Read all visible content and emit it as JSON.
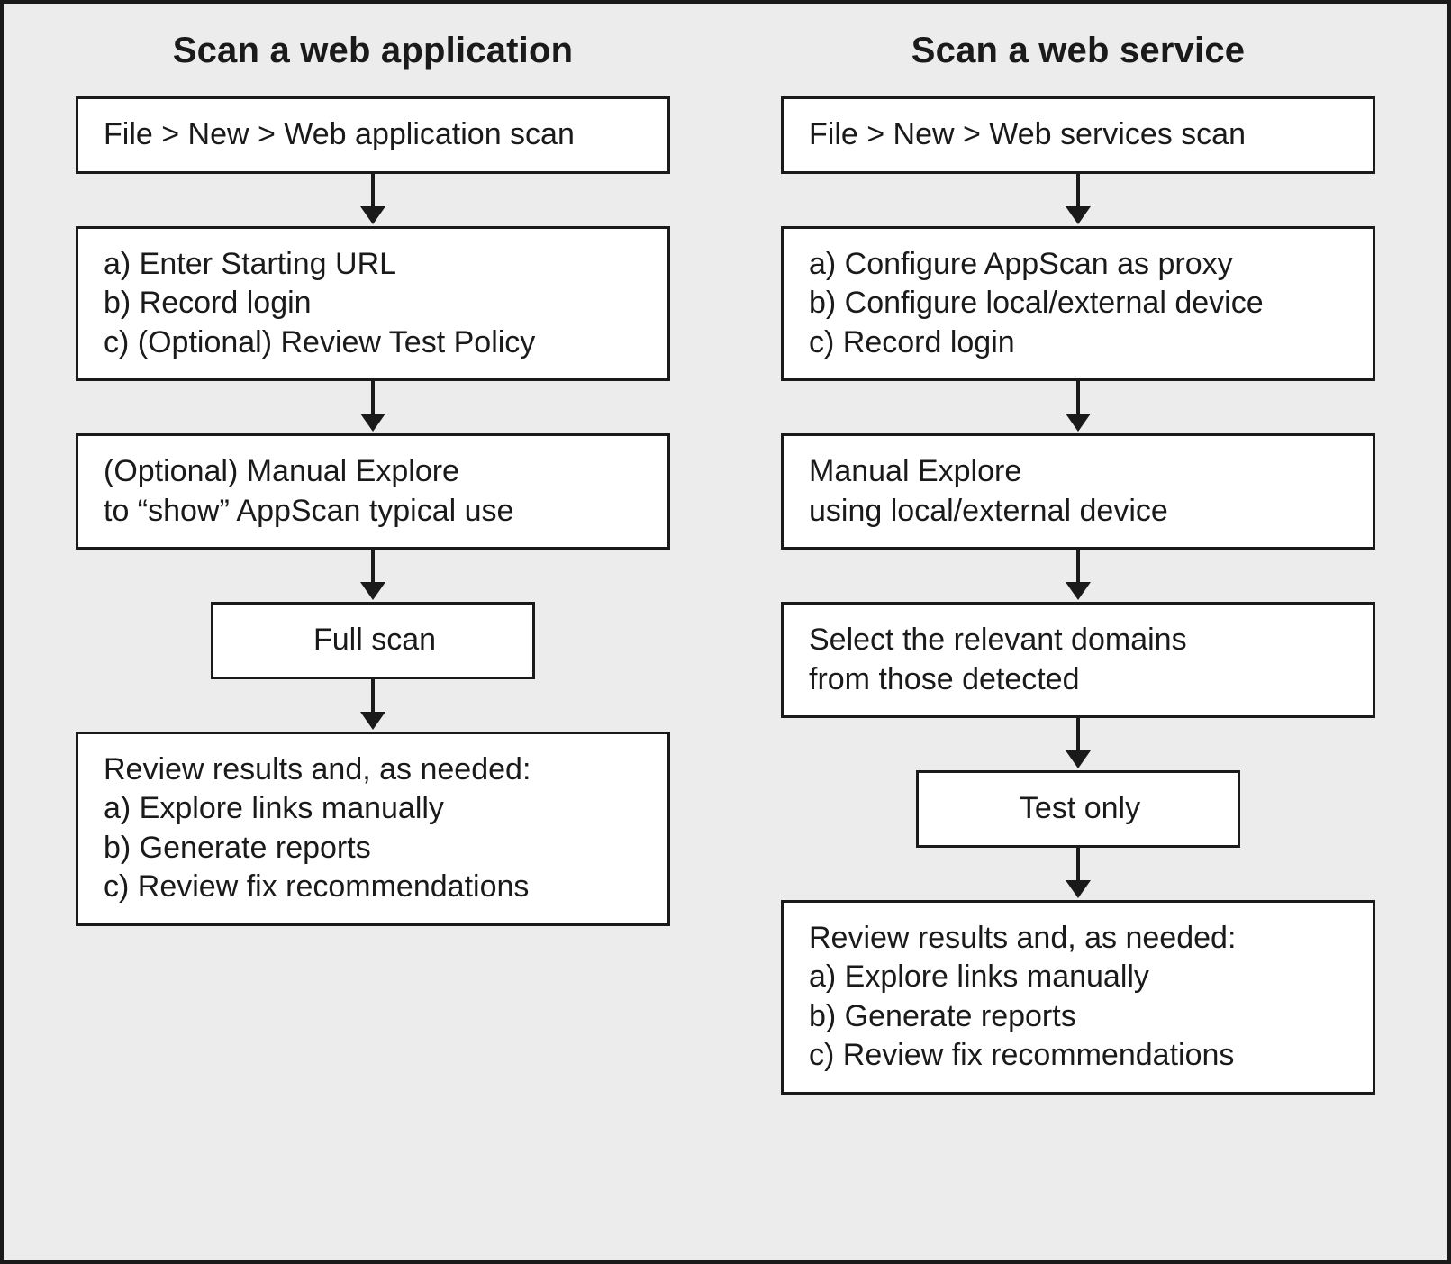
{
  "left": {
    "title": "Scan a web application",
    "step1": "File > New > Web application scan",
    "step2_a": "a) Enter Starting URL",
    "step2_b": "b) Record login",
    "step2_c": "c) (Optional) Review Test Policy",
    "step3_a": "(Optional) Manual Explore",
    "step3_b": "to “show” AppScan typical use",
    "step4": "Full scan",
    "step5_a": "Review results and, as needed:",
    "step5_b": "a) Explore links manually",
    "step5_c": "b) Generate reports",
    "step5_d": "c) Review fix recommendations"
  },
  "right": {
    "title": "Scan a web service",
    "step1": "File > New > Web services scan",
    "step2_a": "a) Configure AppScan as proxy",
    "step2_b": "b) Configure local/external device",
    "step2_c": "c) Record login",
    "step3_a": "Manual Explore",
    "step3_b": "using local/external device",
    "step4_a": "Select the relevant domains",
    "step4_b": "from those detected",
    "step5": "Test only",
    "step6_a": "Review results and, as needed:",
    "step6_b": "a) Explore links manually",
    "step6_c": "b) Generate reports",
    "step6_d": "c) Review fix recommendations"
  }
}
